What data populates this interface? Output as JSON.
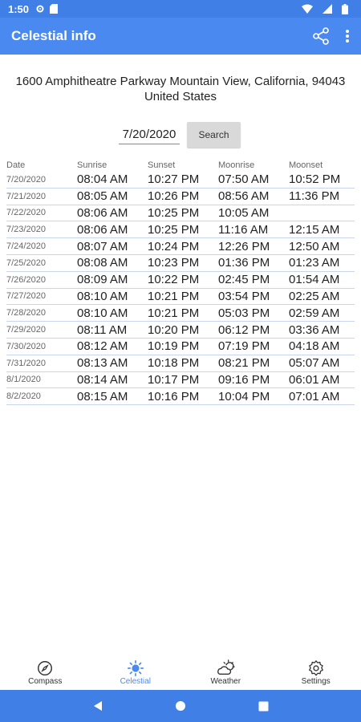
{
  "status_bar": {
    "time": "1:50"
  },
  "app_bar": {
    "title": "Celestial info"
  },
  "address": {
    "line1": "1600 Amphitheatre Parkway Mountain View, California, 94043",
    "line2": "United States"
  },
  "search": {
    "date_value": "7/20/2020",
    "button_label": "Search"
  },
  "table": {
    "headers": [
      "Date",
      "Sunrise",
      "Sunset",
      "Moonrise",
      "Moonset"
    ],
    "rows": [
      [
        "7/20/2020",
        "08:04 AM",
        "10:27 PM",
        "07:50 AM",
        "10:52 PM"
      ],
      [
        "7/21/2020",
        "08:05 AM",
        "10:26 PM",
        "08:56 AM",
        "11:36 PM"
      ],
      [
        "7/22/2020",
        "08:06 AM",
        "10:25 PM",
        "10:05 AM",
        ""
      ],
      [
        "7/23/2020",
        "08:06 AM",
        "10:25 PM",
        "11:16 AM",
        "12:15 AM"
      ],
      [
        "7/24/2020",
        "08:07 AM",
        "10:24 PM",
        "12:26 PM",
        "12:50 AM"
      ],
      [
        "7/25/2020",
        "08:08 AM",
        "10:23 PM",
        "01:36 PM",
        "01:23 AM"
      ],
      [
        "7/26/2020",
        "08:09 AM",
        "10:22 PM",
        "02:45 PM",
        "01:54 AM"
      ],
      [
        "7/27/2020",
        "08:10 AM",
        "10:21 PM",
        "03:54 PM",
        "02:25 AM"
      ],
      [
        "7/28/2020",
        "08:10 AM",
        "10:21 PM",
        "05:03 PM",
        "02:59 AM"
      ],
      [
        "7/29/2020",
        "08:11 AM",
        "10:20 PM",
        "06:12 PM",
        "03:36 AM"
      ],
      [
        "7/30/2020",
        "08:12 AM",
        "10:19 PM",
        "07:19 PM",
        "04:18 AM"
      ],
      [
        "7/31/2020",
        "08:13 AM",
        "10:18 PM",
        "08:21 PM",
        "05:07 AM"
      ],
      [
        "8/1/2020",
        "08:14 AM",
        "10:17 PM",
        "09:16 PM",
        "06:01 AM"
      ],
      [
        "8/2/2020",
        "08:15 AM",
        "10:16 PM",
        "10:04 PM",
        "07:01 AM"
      ]
    ]
  },
  "bottom_nav": {
    "items": [
      {
        "label": "Compass",
        "icon": "compass-icon",
        "active": false
      },
      {
        "label": "Celestial",
        "icon": "sun-icon",
        "active": true
      },
      {
        "label": "Weather",
        "icon": "weather-icon",
        "active": false
      },
      {
        "label": "Settings",
        "icon": "gear-icon",
        "active": false
      }
    ]
  },
  "colors": {
    "primary": "#4a8af0",
    "status_bar": "#3f7fe6",
    "active_nav": "#4a8af0",
    "row_divider": "#c9d4ee"
  }
}
